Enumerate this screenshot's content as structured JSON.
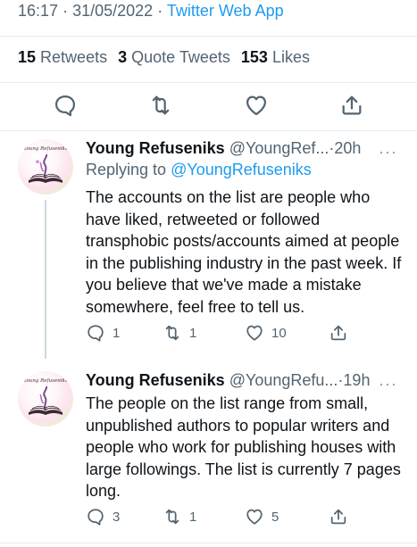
{
  "tweet": {
    "time": "16:17",
    "date": "31/05/2022",
    "separator": "·",
    "via": "Twitter Web App",
    "stats": [
      {
        "count": "15",
        "label": "Retweets"
      },
      {
        "count": "3",
        "label": "Quote Tweets"
      },
      {
        "count": "153",
        "label": "Likes"
      }
    ],
    "actions": [
      "comment-icon",
      "retweet-icon",
      "heart-icon",
      "share-icon"
    ]
  },
  "replies": [
    {
      "name": "Young Refuseniks",
      "handle": "@YoungRef...",
      "dot": "·",
      "age": "20h",
      "replying_prefix": "Replying to",
      "replying_to": "@YoungRefuseniks",
      "text": "The accounts on the list are people who have liked, retweeted or followed transphobic posts/accounts aimed at people in the publishing industry in the past week. If you believe that we've made a mistake somewhere, feel free to tell us.",
      "avatar_text": "Young Refuseniks",
      "counts": {
        "reply": "1",
        "retweet": "1",
        "like": "10"
      }
    },
    {
      "name": "Young Refuseniks",
      "handle": "@YoungRefu...",
      "dot": "·",
      "age": "19h",
      "text": "The people on the list range from small, unpublished authors to popular writers and people who work for publishing houses with large followings. The list is currently 7 pages long.",
      "avatar_text": "Young Refuseniks",
      "counts": {
        "reply": "3",
        "retweet": "1",
        "like": "5"
      }
    }
  ],
  "more_label": "···",
  "colors": {
    "accent": "#1d9bf0",
    "muted": "#536471",
    "text": "#0f1419",
    "divider": "#e6ecf0"
  }
}
